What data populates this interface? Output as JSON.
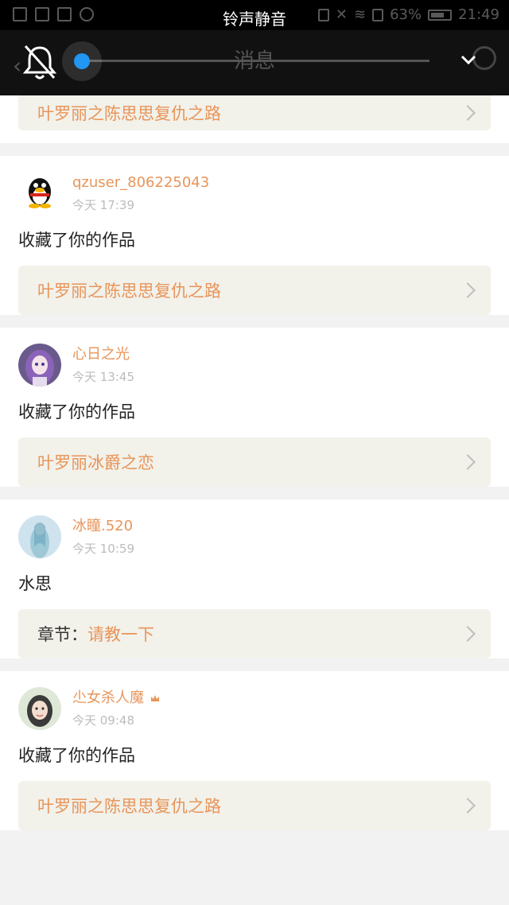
{
  "status_bar": {
    "title": "铃声静音",
    "battery": "63%",
    "time": "21:49"
  },
  "nav": {
    "title": "消息"
  },
  "volume": {
    "level": 0.0,
    "mode_icon": "bell-muted-icon"
  },
  "first_card": {
    "work_title": "叶罗丽之陈思思复仇之路"
  },
  "messages": [
    {
      "username": "qzuser_806225043",
      "time": "今天 17:39",
      "text": "收藏了你的作品",
      "link_prefix": "",
      "link_text": "叶罗丽之陈思思复仇之路"
    },
    {
      "username": "心日之光",
      "time": "今天 13:45",
      "text": "收藏了你的作品",
      "link_prefix": "",
      "link_text": "叶罗丽冰爵之恋"
    },
    {
      "username": "冰瞳.520",
      "time": "今天 10:59",
      "text": "水思",
      "link_prefix": "章节：",
      "link_text": "请教一下"
    },
    {
      "username": "尐女杀人魔",
      "time": "今天 09:48",
      "text": "收藏了你的作品",
      "link_prefix": "",
      "link_text": "叶罗丽之陈思思复仇之路"
    }
  ],
  "colors": {
    "accent": "#e8955a",
    "link_bg": "#f2f1ea",
    "slider": "#2196f3"
  }
}
